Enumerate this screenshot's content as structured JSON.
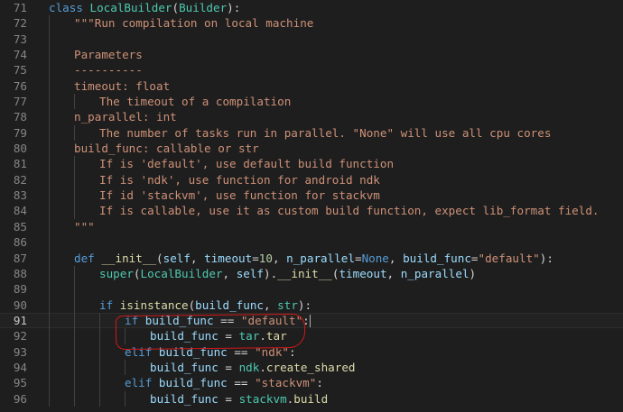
{
  "editor": {
    "colors": {
      "keyword": "#569cd6",
      "classname": "#4ec9b0",
      "function": "#dcdcaa",
      "string": "#ce9178",
      "param": "#9cdcfe",
      "number": "#b5cea8",
      "plain": "#d4d4d4",
      "annotation": "#d11818"
    },
    "lines": [
      {
        "n": "71",
        "indent": 0,
        "tokens": [
          {
            "t": "class ",
            "c": "kw"
          },
          {
            "t": "LocalBuilder",
            "c": "cls"
          },
          {
            "t": "(",
            "c": "pl"
          },
          {
            "t": "Builder",
            "c": "cls"
          },
          {
            "t": "):",
            "c": "pl"
          }
        ]
      },
      {
        "n": "72",
        "indent": 1,
        "tokens": [
          {
            "t": "\"\"\"Run compilation on local machine",
            "c": "str"
          }
        ]
      },
      {
        "n": "73",
        "indent": 1,
        "tokens": []
      },
      {
        "n": "74",
        "indent": 1,
        "tokens": [
          {
            "t": "Parameters",
            "c": "str"
          }
        ]
      },
      {
        "n": "75",
        "indent": 1,
        "tokens": [
          {
            "t": "----------",
            "c": "str"
          }
        ]
      },
      {
        "n": "76",
        "indent": 1,
        "tokens": [
          {
            "t": "timeout: float",
            "c": "str"
          }
        ]
      },
      {
        "n": "77",
        "indent": 2,
        "tokens": [
          {
            "t": "The timeout of a compilation",
            "c": "str"
          }
        ]
      },
      {
        "n": "78",
        "indent": 1,
        "tokens": [
          {
            "t": "n_parallel: int",
            "c": "str"
          }
        ]
      },
      {
        "n": "79",
        "indent": 2,
        "tokens": [
          {
            "t": "The number of tasks run in parallel. \"None\" will use all cpu cores",
            "c": "str"
          }
        ]
      },
      {
        "n": "80",
        "indent": 1,
        "tokens": [
          {
            "t": "build_func: callable or str",
            "c": "str"
          }
        ]
      },
      {
        "n": "81",
        "indent": 2,
        "tokens": [
          {
            "t": "If is 'default', use default build function",
            "c": "str"
          }
        ]
      },
      {
        "n": "82",
        "indent": 2,
        "tokens": [
          {
            "t": "If is 'ndk', use function for android ndk",
            "c": "str"
          }
        ]
      },
      {
        "n": "83",
        "indent": 2,
        "tokens": [
          {
            "t": "If id 'stackvm', use function for stackvm",
            "c": "str"
          }
        ]
      },
      {
        "n": "84",
        "indent": 2,
        "tokens": [
          {
            "t": "If is callable, use it as custom build function, expect lib_format field.",
            "c": "str"
          }
        ]
      },
      {
        "n": "85",
        "indent": 1,
        "tokens": [
          {
            "t": "\"\"\"",
            "c": "str"
          }
        ]
      },
      {
        "n": "86",
        "indent": 1,
        "tokens": []
      },
      {
        "n": "87",
        "indent": 1,
        "tokens": [
          {
            "t": "def ",
            "c": "kw"
          },
          {
            "t": "__init__",
            "c": "fn"
          },
          {
            "t": "(",
            "c": "pl"
          },
          {
            "t": "self",
            "c": "par"
          },
          {
            "t": ", ",
            "c": "pl"
          },
          {
            "t": "timeout",
            "c": "par"
          },
          {
            "t": "=",
            "c": "pl"
          },
          {
            "t": "10",
            "c": "num"
          },
          {
            "t": ", ",
            "c": "pl"
          },
          {
            "t": "n_parallel",
            "c": "par"
          },
          {
            "t": "=",
            "c": "pl"
          },
          {
            "t": "None",
            "c": "kw"
          },
          {
            "t": ", ",
            "c": "pl"
          },
          {
            "t": "build_func",
            "c": "par"
          },
          {
            "t": "=",
            "c": "pl"
          },
          {
            "t": "\"default\"",
            "c": "str"
          },
          {
            "t": "):",
            "c": "pl"
          }
        ]
      },
      {
        "n": "88",
        "indent": 2,
        "tokens": [
          {
            "t": "super",
            "c": "cls"
          },
          {
            "t": "(",
            "c": "pl"
          },
          {
            "t": "LocalBuilder",
            "c": "cls"
          },
          {
            "t": ", ",
            "c": "pl"
          },
          {
            "t": "self",
            "c": "par"
          },
          {
            "t": ").",
            "c": "pl"
          },
          {
            "t": "__init__",
            "c": "fn"
          },
          {
            "t": "(",
            "c": "pl"
          },
          {
            "t": "timeout",
            "c": "par"
          },
          {
            "t": ", ",
            "c": "pl"
          },
          {
            "t": "n_parallel",
            "c": "par"
          },
          {
            "t": ")",
            "c": "pl"
          }
        ]
      },
      {
        "n": "89",
        "indent": 2,
        "tokens": []
      },
      {
        "n": "90",
        "indent": 2,
        "tokens": [
          {
            "t": "if ",
            "c": "kw"
          },
          {
            "t": "isinstance",
            "c": "fn"
          },
          {
            "t": "(",
            "c": "pl"
          },
          {
            "t": "build_func",
            "c": "par"
          },
          {
            "t": ", ",
            "c": "pl"
          },
          {
            "t": "str",
            "c": "cls"
          },
          {
            "t": "):",
            "c": "pl"
          }
        ]
      },
      {
        "n": "91",
        "indent": 3,
        "current": true,
        "tokens": [
          {
            "t": "if ",
            "c": "kw"
          },
          {
            "t": "build_func",
            "c": "par"
          },
          {
            "t": " == ",
            "c": "pl"
          },
          {
            "t": "\"default\"",
            "c": "str"
          },
          {
            "t": ":",
            "c": "pl"
          }
        ]
      },
      {
        "n": "92",
        "indent": 4,
        "tokens": [
          {
            "t": "build_func",
            "c": "par"
          },
          {
            "t": " = ",
            "c": "pl"
          },
          {
            "t": "tar",
            "c": "cls"
          },
          {
            "t": ".",
            "c": "pl"
          },
          {
            "t": "tar",
            "c": "fn"
          }
        ]
      },
      {
        "n": "93",
        "indent": 3,
        "tokens": [
          {
            "t": "elif ",
            "c": "kw"
          },
          {
            "t": "build_func",
            "c": "par"
          },
          {
            "t": " == ",
            "c": "pl"
          },
          {
            "t": "\"ndk\"",
            "c": "str"
          },
          {
            "t": ":",
            "c": "pl"
          }
        ]
      },
      {
        "n": "94",
        "indent": 4,
        "tokens": [
          {
            "t": "build_func",
            "c": "par"
          },
          {
            "t": " = ",
            "c": "pl"
          },
          {
            "t": "ndk",
            "c": "cls"
          },
          {
            "t": ".",
            "c": "pl"
          },
          {
            "t": "create_shared",
            "c": "fn"
          }
        ]
      },
      {
        "n": "95",
        "indent": 3,
        "tokens": [
          {
            "t": "elif ",
            "c": "kw"
          },
          {
            "t": "build_func",
            "c": "par"
          },
          {
            "t": " == ",
            "c": "pl"
          },
          {
            "t": "\"stackvm\"",
            "c": "str"
          },
          {
            "t": ":",
            "c": "pl"
          }
        ]
      },
      {
        "n": "96",
        "indent": 4,
        "tokens": [
          {
            "t": "build_func",
            "c": "par"
          },
          {
            "t": " = ",
            "c": "pl"
          },
          {
            "t": "stackvm",
            "c": "cls"
          },
          {
            "t": ".",
            "c": "pl"
          },
          {
            "t": "build",
            "c": "fn"
          }
        ]
      }
    ]
  }
}
